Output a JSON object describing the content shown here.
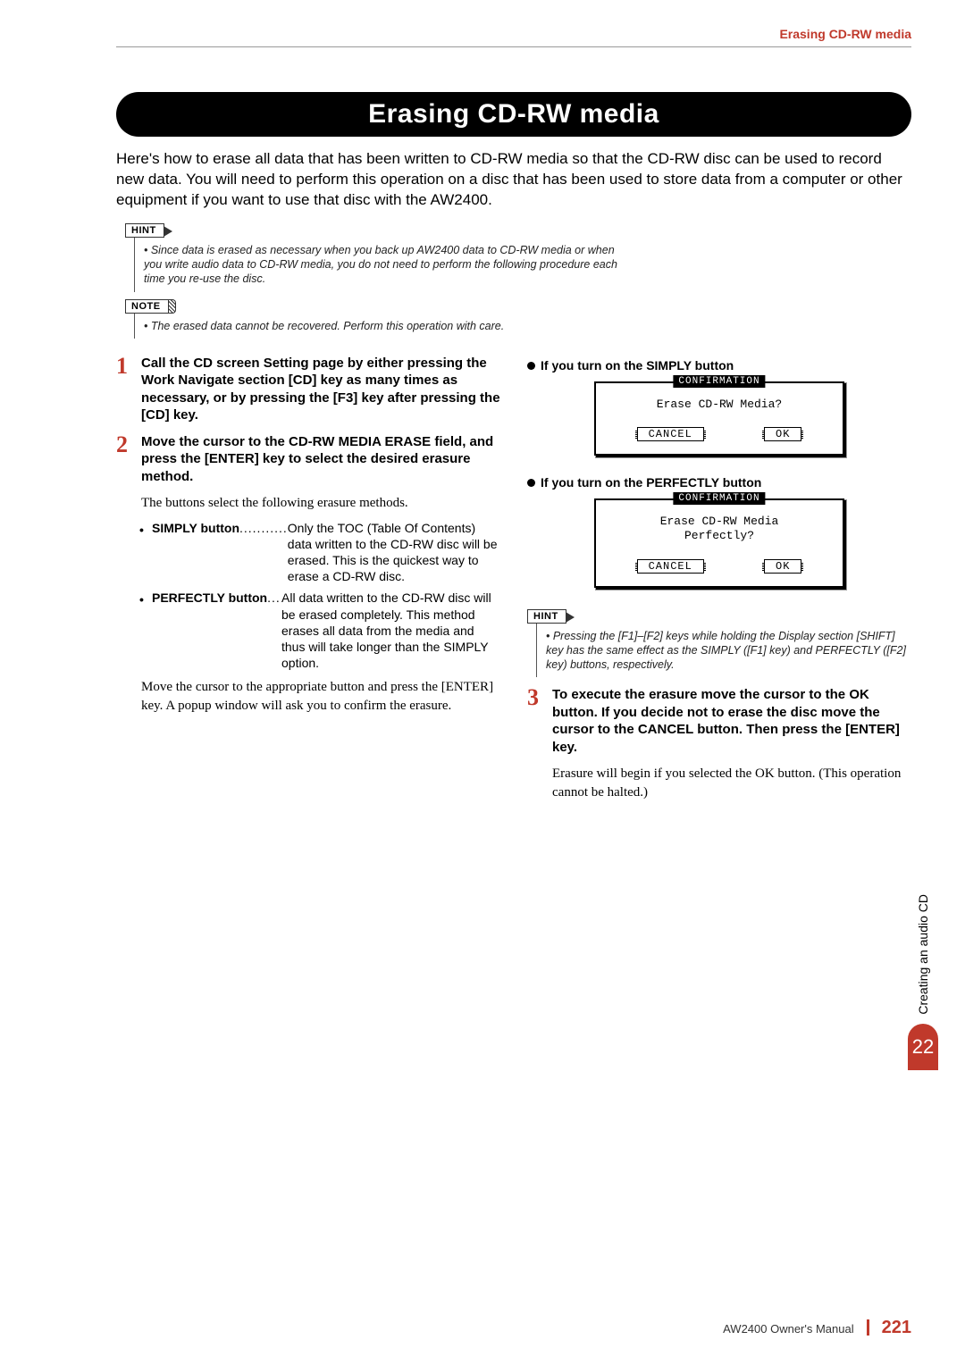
{
  "running_head": "Erasing CD-RW media",
  "title": "Erasing CD-RW media",
  "intro": "Here's how to erase all data that has been written to CD-RW media so that the CD-RW disc can be used to record new data. You will need to perform this operation on a disc that has been used to store data from a computer or other equipment if you want to use that disc with the AW2400.",
  "hint1_label": "HINT",
  "hint1_body": "• Since data is erased as necessary when you back up AW2400 data to CD-RW media or when you write audio data to CD-RW media, you do not need to perform the following procedure each time you re-use the disc.",
  "note1_label": "NOTE",
  "note1_body": "• The erased data cannot be recovered. Perform this operation with care.",
  "step1_num": "1",
  "step1_head": "Call the CD screen Setting page by either pressing the Work Navigate section [CD] key as many times as necessary, or by pressing the [F3] key after pressing the [CD] key.",
  "step2_num": "2",
  "step2_head": "Move the cursor to the CD-RW MEDIA ERASE field, and press the [ENTER] key to select the desired erasure method.",
  "step2_body": "The buttons select the following erasure methods.",
  "defs": [
    {
      "term": "SIMPLY button",
      "dots": "...........",
      "desc": "Only the TOC (Table Of Contents) data written to the CD-RW disc will be erased. This is the quickest way to erase a CD-RW disc."
    },
    {
      "term": "PERFECTLY button",
      "dots": "...",
      "desc": "All data written to the CD-RW disc will be erased completely. This method erases all data from the media and thus will take longer than the SIMPLY option."
    }
  ],
  "step2_tail": "Move the cursor to the appropriate button and press the [ENTER] key. A popup window will ask you to confirm the erasure.",
  "rcol": {
    "sub1": "If you turn on the SIMPLY button",
    "dlg1_title": "CONFIRMATION",
    "dlg1_msg": "Erase CD-RW Media?",
    "dlg_cancel": "CANCEL",
    "dlg_ok": "OK",
    "sub2": "If you turn on the PERFECTLY button",
    "dlg2_title": "CONFIRMATION",
    "dlg2_msg": "Erase CD-RW Media\nPerfectly?",
    "hint2_label": "HINT",
    "hint2_body": "• Pressing the [F1]–[F2] keys while holding the Display section [SHIFT] key has the same effect as the SIMPLY ([F1] key) and PERFECTLY ([F2] key) buttons, respectively.",
    "step3_num": "3",
    "step3_head": "To execute the erasure move the cursor to the OK button. If you decide not to erase the disc move the cursor to the CANCEL button. Then press the [ENTER] key.",
    "step3_body": "Erasure will begin if you selected the OK button. (This operation cannot be halted.)"
  },
  "side": {
    "label": "Creating an audio CD",
    "num": "22"
  },
  "footer": {
    "manual": "AW2400  Owner's Manual",
    "page": "221"
  }
}
